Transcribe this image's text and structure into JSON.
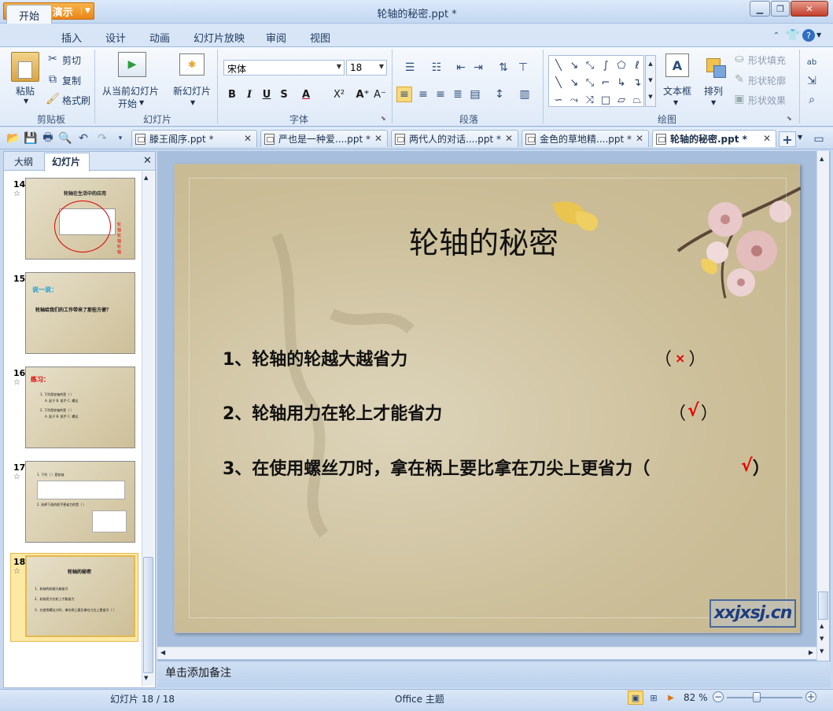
{
  "app": {
    "name": "WPS 演示",
    "window_title": "轮轴的秘密.ppt *"
  },
  "ribbon_tabs": [
    "开始",
    "插入",
    "设计",
    "动画",
    "幻灯片放映",
    "审阅",
    "视图"
  ],
  "clipboard": {
    "paste": "粘贴",
    "cut": "剪切",
    "copy": "复制",
    "format_painter": "格式刷",
    "group": "剪贴板"
  },
  "slides_group": {
    "from_current_l1": "从当前幻灯片",
    "from_current_l2": "开始",
    "new_slide": "新幻灯片",
    "group": "幻灯片"
  },
  "font": {
    "name": "宋体",
    "size": "18",
    "group": "字体",
    "bold": "B",
    "italic": "I",
    "underline": "U",
    "shadow": "S",
    "color": "A",
    "superscript": "X²",
    "grow": "A⁺",
    "shrink": "A⁻"
  },
  "paragraph": {
    "group": "段落"
  },
  "drawing": {
    "text_box": "文本框",
    "arrange": "排列",
    "shape_fill": "形状填充",
    "shape_outline": "形状轮廓",
    "shape_effect": "形状效果",
    "group": "绘图"
  },
  "doc_tabs": [
    "滕王阁序.ppt *",
    "严也是一种爱....ppt *",
    "两代人的对话....ppt *",
    "金色的草地精....ppt *",
    "轮轴的秘密.ppt *"
  ],
  "pane": {
    "outline_tab": "大纲",
    "slides_tab": "幻灯片"
  },
  "thumbnails": [
    {
      "num": "14",
      "title": "轮轴在生活中的应用",
      "caption": "轮轴 轮轴 轮轴"
    },
    {
      "num": "15",
      "title": "说一说：",
      "body": "轮轴给我们的工作带来了那些方便？"
    },
    {
      "num": "16",
      "title": "练习：",
      "line1": "1. 下列是轮轴的是（  ）",
      "opts1": "A. 起子   B. 扳手   C. 螺丝",
      "line2": "2. 下列是轮轴的是（  ）",
      "opts2": "A. 起子   B. 扳手   C. 螺丝"
    },
    {
      "num": "17",
      "line1": "1. 下列（  ）是轮轴",
      "line2": "2. 选择下面的扳手更省力的是（  ）"
    },
    {
      "num": "18",
      "title": "轮轴的秘密",
      "l1": "1、轮轴的轮越大越省力",
      "l2": "2、轮轴用力在轮上才能省力",
      "l3": "3、在使用螺丝刀时，拿在柄上要比拿在刀尖上更省力（  ）"
    }
  ],
  "slide": {
    "title": "轮轴的秘密",
    "items": [
      {
        "text": "1、轮轴的轮越大越省力",
        "open": "（",
        "mark": "×",
        "close": "）"
      },
      {
        "text": "2、轮轴用力在轮上才能省力",
        "open": "（",
        "mark": "√",
        "close": "）"
      },
      {
        "text": "3、在使用螺丝刀时，拿在柄上要比拿在刀尖上更省力（",
        "open": "",
        "mark": "√",
        "close": "）"
      }
    ],
    "watermark": "xxjxsj.cn"
  },
  "notes_placeholder": "单击添加备注",
  "status": {
    "slide_counter": "幻灯片 18 / 18",
    "theme": "Office 主题",
    "zoom": "82 %"
  },
  "colors": {
    "accent": "#e8851a",
    "check_mark": "#e60000"
  }
}
